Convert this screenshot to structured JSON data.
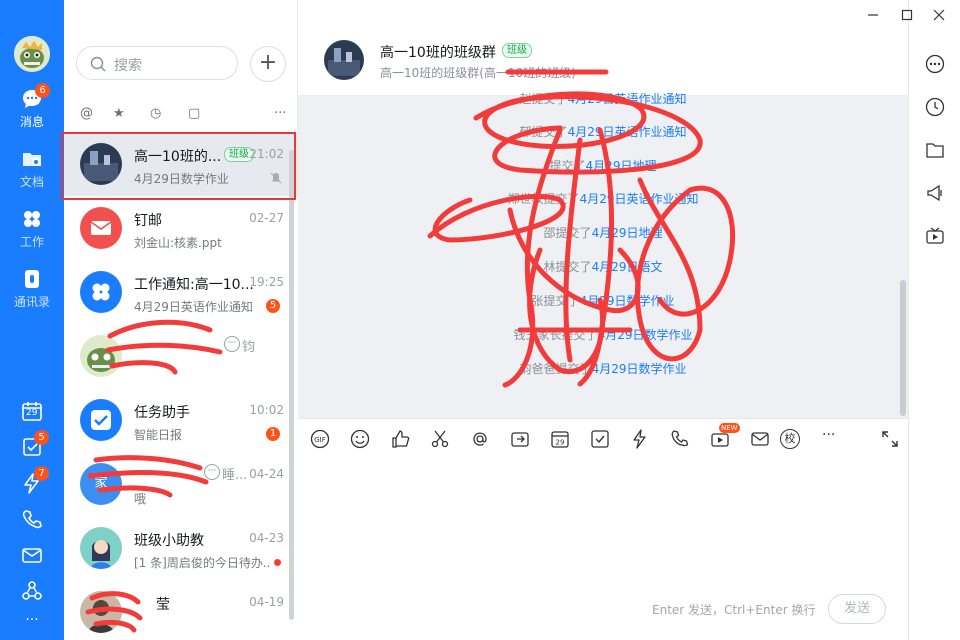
{
  "nav": {
    "items": [
      {
        "label": "消息",
        "badge": "6"
      },
      {
        "label": "文档"
      },
      {
        "label": "工作"
      },
      {
        "label": "通讯录"
      }
    ],
    "lower": [
      {
        "icon": "calendar-icon",
        "text": "29"
      },
      {
        "icon": "todo-icon",
        "badge": "5"
      },
      {
        "icon": "ding-icon",
        "badge": "7"
      },
      {
        "icon": "phone-icon"
      },
      {
        "icon": "mail-icon"
      },
      {
        "icon": "org-icon"
      },
      {
        "icon": "more-icon",
        "text": "···"
      }
    ]
  },
  "search": {
    "placeholder": "搜索"
  },
  "add_button": "+",
  "filters": [
    "@",
    "★",
    "◷",
    "▢",
    "···"
  ],
  "sessions": [
    {
      "name": "高一10班的...",
      "tag": "班级",
      "time": "21:02",
      "preview": "4月29日数学作业",
      "selected": true
    },
    {
      "name": "钉邮",
      "time": "02-27",
      "preview": "刘金山:核素.ppt"
    },
    {
      "name": "工作通知:高一10...",
      "time": "19:25",
      "preview": "4月29日英语作业通知",
      "badge": "5"
    },
    {
      "name": "",
      "time": "",
      "preview": "",
      "suffix": "钧"
    },
    {
      "name": "任务助手",
      "time": "10:02",
      "preview": "智能日报",
      "badge": "1"
    },
    {
      "name": "家",
      "time": "04-24",
      "preview": "哦",
      "suffix": "睡..."
    },
    {
      "name": "班级小助教",
      "time": "04-23",
      "preview": "[1 条]周启俊的今日待办..."
    },
    {
      "name": "莹",
      "time": "04-19",
      "preview": ""
    }
  ],
  "chat": {
    "title": "高一10班的班级群",
    "tag": "班级",
    "subtitle": "高一10班的班级群(高一10班的班级)",
    "messages": [
      {
        "who": "赵",
        "action": "提交了",
        "link": "4月29日英语作业通知"
      },
      {
        "who": "郁",
        "action": "提交了",
        "link": "4月29日英语作业通知"
      },
      {
        "who": "",
        "action": "提交了",
        "link": "4月29日地理"
      },
      {
        "who": "郑世权",
        "action": "提交了",
        "link": "4月29日英语作业通知"
      },
      {
        "who": "邵",
        "action": "提交了",
        "link": "4月29日地理"
      },
      {
        "who": "林",
        "action": "提交了",
        "link": "4月29日语文"
      },
      {
        "who": "张",
        "action": "提交了",
        "link": "4月29日数学作业"
      },
      {
        "who": "钱王家长",
        "action": "提交了",
        "link": "4月29日数学作业"
      },
      {
        "who": "韵爸爸",
        "action": "提交了",
        "link": "4月29日数学作业"
      }
    ],
    "input_hint": "Enter 发送，Ctrl+Enter 换行",
    "send_label": "发送",
    "new_tag": "NEW",
    "school_label": "校",
    "cal_day": "29"
  }
}
